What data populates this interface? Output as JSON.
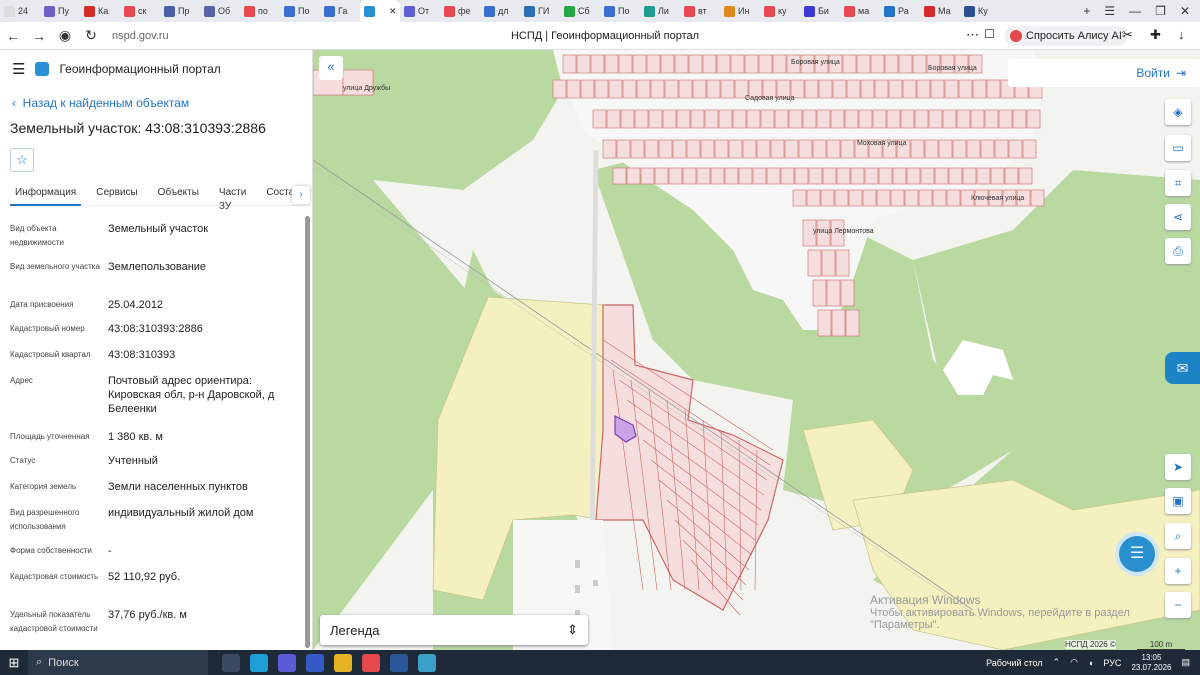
{
  "browser": {
    "tabs": [
      {
        "label": "24",
        "color": "#dddddd"
      },
      {
        "label": "Пу",
        "color": "#6c5fc7"
      },
      {
        "label": "Ка",
        "color": "#d62b2b"
      },
      {
        "label": "ск",
        "color": "#e5484d"
      },
      {
        "label": "Пр",
        "color": "#4b5ea8"
      },
      {
        "label": "Об",
        "color": "#5864a8"
      },
      {
        "label": "по",
        "color": "#e5484d"
      },
      {
        "label": "По",
        "color": "#3d6fd1"
      },
      {
        "label": "Га",
        "color": "#3b6fd1"
      },
      {
        "label": "",
        "color": "#2b8fd6"
      },
      {
        "label": "От",
        "color": "#5e5ed6"
      },
      {
        "label": "фе",
        "color": "#e5484d"
      },
      {
        "label": "дл",
        "color": "#3d6fd1"
      },
      {
        "label": "ГИ",
        "color": "#2c6fb3"
      },
      {
        "label": "Сб",
        "color": "#27a844"
      },
      {
        "label": "По",
        "color": "#3d6fd1"
      },
      {
        "label": "Ли",
        "color": "#1f9b8f"
      },
      {
        "label": "вт",
        "color": "#e5484d"
      },
      {
        "label": "Ин",
        "color": "#e08a1c"
      },
      {
        "label": "ку",
        "color": "#e5484d"
      },
      {
        "label": "Би",
        "color": "#3a3ad1"
      },
      {
        "label": "ма",
        "color": "#e5484d"
      },
      {
        "label": "Ра",
        "color": "#2474c6"
      },
      {
        "label": "Ма",
        "color": "#d62b2b"
      },
      {
        "label": "Ку",
        "color": "#2c4f8f"
      }
    ],
    "url": "nspd.gov.ru",
    "page_title": "НСПД | Геоинформационный портал",
    "alisa_label": "Спросить Алису AI"
  },
  "panel": {
    "app_title": "Геоинформационный портал",
    "back_link": "Назад к найденным объектам",
    "title": "Земельный участок: 43:08:310393:2886",
    "tabs": [
      "Информация",
      "Сервисы",
      "Объекты",
      "Части ЗУ",
      "Состав"
    ],
    "properties": [
      {
        "key": "Вид объекта недвижимости",
        "value": "Земельный участок"
      },
      {
        "key": "Вид земельного участка",
        "value": "Землепользование"
      },
      {
        "key": "Дата присвоения",
        "value": "25.04.2012"
      },
      {
        "key": "Кадастровый номер",
        "value": "43:08:310393:2886"
      },
      {
        "key": "Кадастровый квартал",
        "value": "43:08:310393"
      },
      {
        "key": "Адрес",
        "value": "Почтовый адрес ориентира: Кировская обл, р-н Даровской, д Белеенки"
      },
      {
        "key": "Площадь уточненная",
        "value": "1 380 кв. м"
      },
      {
        "key": "Статус",
        "value": "Учтенный"
      },
      {
        "key": "Категория земель",
        "value": "Земли населенных пунктов"
      },
      {
        "key": "Вид разрешенного использования",
        "value": "индивидуальный жилой дом"
      },
      {
        "key": "Форма собственности",
        "value": "-"
      },
      {
        "key": "Кадастровая стоимость",
        "value": "52 110,92 руб."
      },
      {
        "key": "Удельный показатель кадастровой стоимости",
        "value": "37,76 руб./кв. м"
      }
    ]
  },
  "map": {
    "login_label": "Войти",
    "legend_label": "Легенда",
    "streets": [
      "улица Дружбы",
      "Боровая улица",
      "Боровая улица",
      "Садовая улица",
      "Моховая улица",
      "Ключевая улица",
      "улица Лермонтова"
    ],
    "watermark_title": "Активация Windows",
    "watermark_text": "Чтобы активировать Windows, перейдите в раздел \"Параметры\".",
    "attribution": "НСПД 2026 ©",
    "scale": "100 m"
  },
  "taskbar": {
    "search_label": "Поиск",
    "desktop_label": "Рабочий стол",
    "lang": "РУС",
    "time": "13:05",
    "date": "23.07.2026"
  }
}
